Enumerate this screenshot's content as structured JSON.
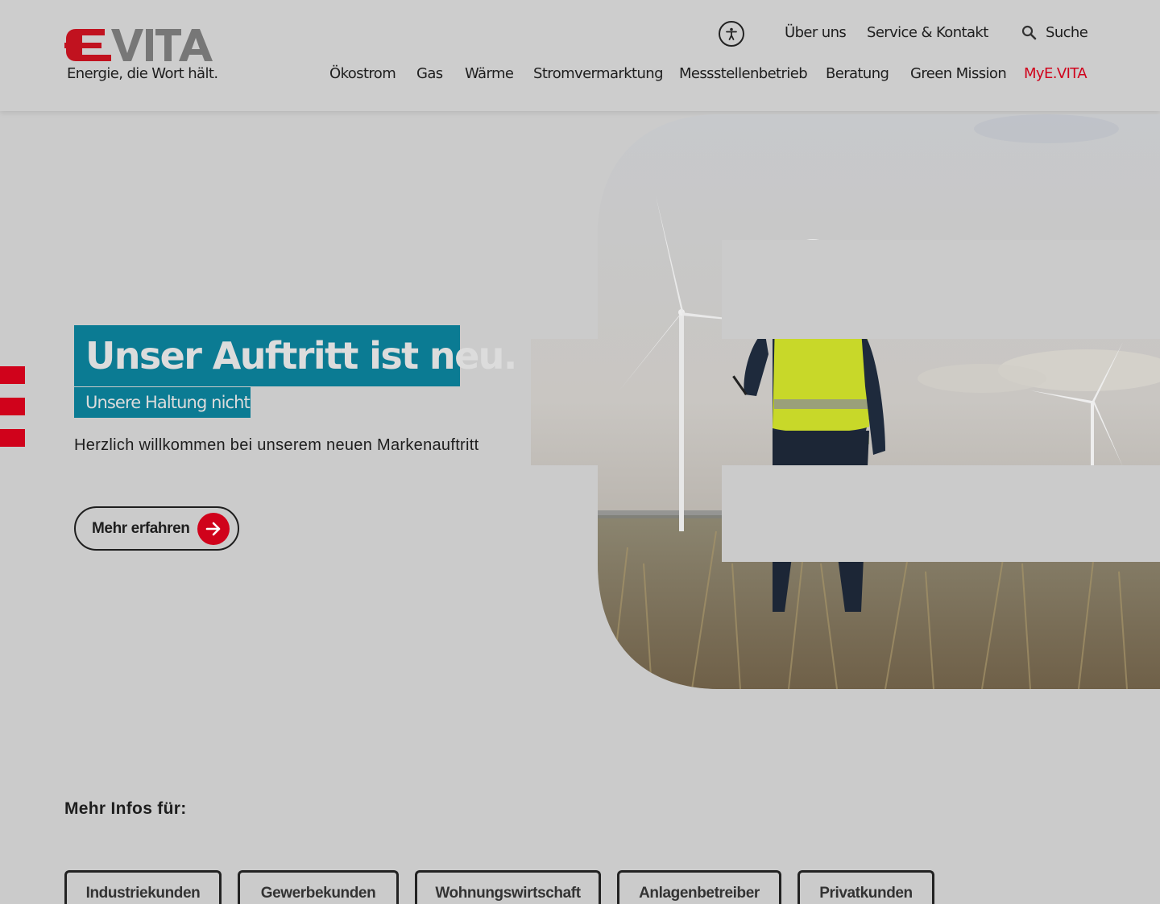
{
  "brand": {
    "logo_text": "E.VITA",
    "tagline": "Energie, die Wort hält.",
    "accent_color": "#d0021b",
    "teal_color": "#0b7b93"
  },
  "header": {
    "accessibility_icon": "accessibility-icon",
    "meta_links": [
      "Über uns",
      "Service & Kontakt"
    ],
    "search_label": "Suche",
    "search_icon": "search-icon"
  },
  "main_nav": {
    "items": [
      "Ökostrom",
      "Gas",
      "Wärme",
      "Stromvermarktung",
      "Messstellenbetrieb",
      "Beratung",
      "Green Mission",
      "MyE.VITA"
    ]
  },
  "hero": {
    "title": "Unser Auftritt ist neu.",
    "subtitle": "Unsere Haltung nicht",
    "text": "Herzlich willkommen bei unserem neuen Markenauftritt",
    "cta_label": "Mehr erfahren",
    "cta_icon": "arrow-right-icon"
  },
  "info": {
    "heading": "Mehr Infos für:",
    "tiles": [
      "Industriekunden",
      "Gewerbekunden",
      "Wohnungswirtschaft",
      "Anlagenbetreiber",
      "Privatkunden"
    ]
  }
}
